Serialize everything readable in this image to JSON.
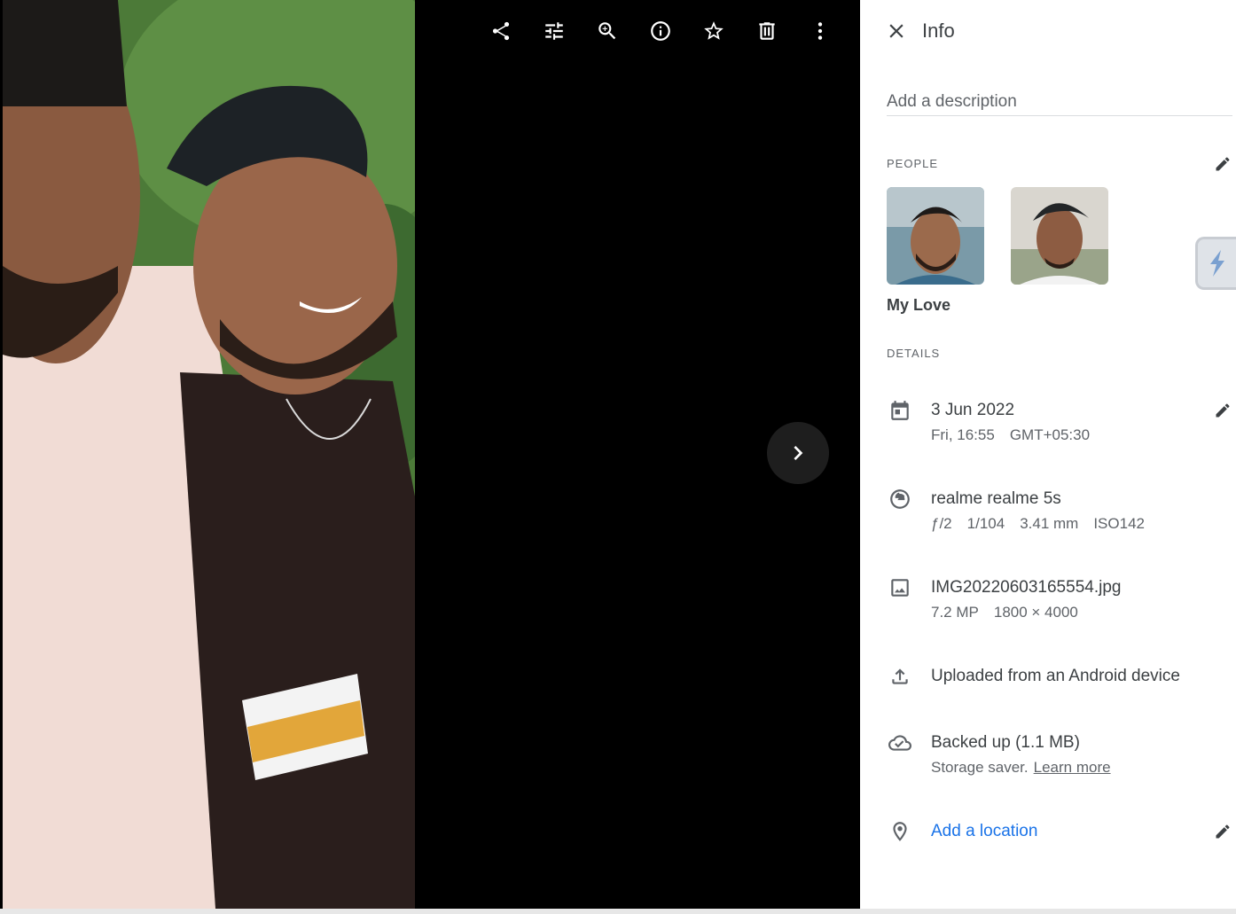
{
  "toolbar": {
    "buttons": [
      {
        "icon": "share-icon"
      },
      {
        "icon": "edit-adjust-icon"
      },
      {
        "icon": "zoom-in-icon"
      },
      {
        "icon": "info-icon"
      },
      {
        "icon": "star-icon"
      },
      {
        "icon": "delete-icon"
      },
      {
        "icon": "more-vertical-icon"
      }
    ],
    "next_icon": "chevron-right-icon"
  },
  "panel": {
    "title": "Info",
    "description_placeholder": "Add a description",
    "people": {
      "section_title": "PEOPLE",
      "faces": [
        {
          "name": "My Love"
        },
        {
          "name": ""
        }
      ]
    },
    "details": {
      "section_title": "DETAILS",
      "date": {
        "main": "3 Jun 2022",
        "day_time": "Fri, 16:55",
        "timezone": "GMT+05:30"
      },
      "camera": {
        "main": "realme realme 5s",
        "aperture": "ƒ/2",
        "shutter": "1/104",
        "focal": "3.41 mm",
        "iso": "ISO142"
      },
      "file": {
        "main": "IMG20220603165554.jpg",
        "megapixels": "7.2 MP",
        "resolution": "1800 × 4000"
      },
      "upload": {
        "main": "Uploaded from an Android device"
      },
      "backup": {
        "main": "Backed up (1.1 MB)",
        "sub": "Storage saver.",
        "link": "Learn more"
      },
      "location": {
        "main": "Add a location"
      }
    }
  },
  "colors": {
    "accent": "#1a73e8",
    "viewer_bg": "#000000",
    "text": "#3c4043",
    "secondary_text": "#5f6368"
  }
}
